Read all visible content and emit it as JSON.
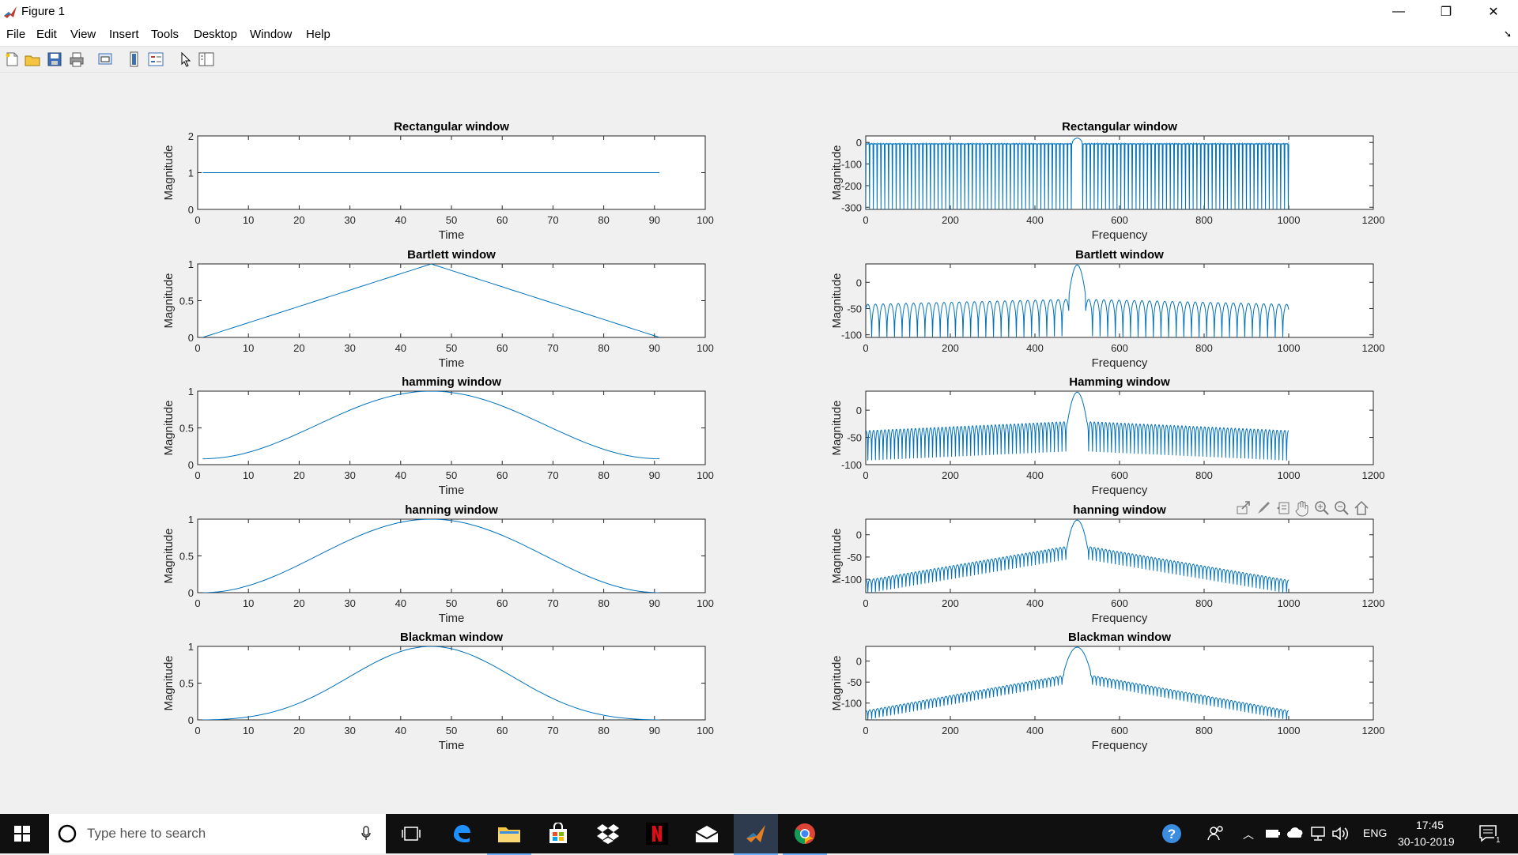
{
  "window": {
    "title": "Figure 1",
    "minimize": "—",
    "maximize": "❐",
    "close": "✕"
  },
  "menu": [
    "File",
    "Edit",
    "View",
    "Insert",
    "Tools",
    "Desktop",
    "Window",
    "Help"
  ],
  "toolbar_icons": [
    "new-figure-icon",
    "open-icon",
    "save-icon",
    "print-icon",
    "link-plot-icon",
    "colorbar-icon",
    "legend-icon",
    "pointer-icon",
    "property-inspector-icon"
  ],
  "axes_toolbar_icons": [
    "export-icon",
    "brush-icon",
    "data-tips-icon",
    "pan-hand-icon",
    "zoom-in-icon",
    "zoom-out-icon",
    "home-icon"
  ],
  "chart_data": [
    {
      "type": "line",
      "title": "Rectangular window",
      "xlabel": "Time",
      "ylabel": "Magnitude",
      "xlim": [
        0,
        100
      ],
      "ylim": [
        0,
        2
      ],
      "xticks": [
        "0",
        "10",
        "20",
        "30",
        "40",
        "50",
        "60",
        "70",
        "80",
        "90",
        "100"
      ],
      "yticks": [
        "0",
        "1",
        "2"
      ],
      "series_kind": "rect",
      "x_end": 91,
      "value": 1
    },
    {
      "type": "line",
      "title": "Rectangular window",
      "xlabel": "Frequency",
      "ylabel": "Magnitude",
      "xlim": [
        0,
        1200
      ],
      "ylim": [
        -310,
        30
      ],
      "xticks": [
        "0",
        "200",
        "400",
        "600",
        "800",
        "1000",
        "1200"
      ],
      "yticks": [
        "-300",
        "-200",
        "-100",
        "0"
      ],
      "series_kind": "spectrum_rect",
      "x_end": 1000,
      "peak_x": 500,
      "peak_db": 20
    },
    {
      "type": "line",
      "title": "Bartlett window",
      "xlabel": "Time",
      "ylabel": "Magnitude",
      "xlim": [
        0,
        100
      ],
      "ylim": [
        0,
        1
      ],
      "xticks": [
        "0",
        "10",
        "20",
        "30",
        "40",
        "50",
        "60",
        "70",
        "80",
        "90",
        "100"
      ],
      "yticks": [
        "0",
        "0.5",
        "1"
      ],
      "series_kind": "bartlett",
      "x_start": 1,
      "x_end": 91
    },
    {
      "type": "line",
      "title": "Bartlett window",
      "xlabel": "Frequency",
      "ylabel": "Magnitude",
      "xlim": [
        0,
        1200
      ],
      "ylim": [
        -105,
        35
      ],
      "xticks": [
        "0",
        "200",
        "400",
        "600",
        "800",
        "1000",
        "1200"
      ],
      "yticks": [
        "-100",
        "-50",
        "0"
      ],
      "series_kind": "spectrum_bartlett",
      "x_end": 1000,
      "peak_x": 500,
      "peak_db": 33
    },
    {
      "type": "line",
      "title": "hamming window",
      "xlabel": "Time",
      "ylabel": "Magnitude",
      "xlim": [
        0,
        100
      ],
      "ylim": [
        0,
        1
      ],
      "xticks": [
        "0",
        "10",
        "20",
        "30",
        "40",
        "50",
        "60",
        "70",
        "80",
        "90",
        "100"
      ],
      "yticks": [
        "0",
        "0.5",
        "1"
      ],
      "series_kind": "hamming",
      "x_start": 1,
      "x_end": 91
    },
    {
      "type": "line",
      "title": "Hamming window",
      "xlabel": "Frequency",
      "ylabel": "Magnitude",
      "xlim": [
        0,
        1200
      ],
      "ylim": [
        -100,
        35
      ],
      "xticks": [
        "0",
        "200",
        "400",
        "600",
        "800",
        "1000",
        "1200"
      ],
      "yticks": [
        "-100",
        "-50",
        "0"
      ],
      "series_kind": "spectrum_hamming",
      "x_end": 1000,
      "peak_x": 500,
      "peak_db": 33
    },
    {
      "type": "line",
      "title": "hanning window",
      "xlabel": "Time",
      "ylabel": "Magnitude",
      "xlim": [
        0,
        100
      ],
      "ylim": [
        0,
        1
      ],
      "xticks": [
        "0",
        "10",
        "20",
        "30",
        "40",
        "50",
        "60",
        "70",
        "80",
        "90",
        "100"
      ],
      "yticks": [
        "0",
        "0.5",
        "1"
      ],
      "series_kind": "hanning",
      "x_start": 1,
      "x_end": 91
    },
    {
      "type": "line",
      "title": "hanning window",
      "xlabel": "Frequency",
      "ylabel": "Magnitude",
      "xlim": [
        0,
        1200
      ],
      "ylim": [
        -130,
        35
      ],
      "xticks": [
        "0",
        "200",
        "400",
        "600",
        "800",
        "1000",
        "1200"
      ],
      "yticks": [
        "-100",
        "-50",
        "0"
      ],
      "series_kind": "spectrum_hanning",
      "x_end": 1000,
      "peak_x": 500,
      "peak_db": 33
    },
    {
      "type": "line",
      "title": "Blackman window",
      "xlabel": "Time",
      "ylabel": "Magnitude",
      "xlim": [
        0,
        100
      ],
      "ylim": [
        0,
        1
      ],
      "xticks": [
        "0",
        "10",
        "20",
        "30",
        "40",
        "50",
        "60",
        "70",
        "80",
        "90",
        "100"
      ],
      "yticks": [
        "0",
        "0.5",
        "1"
      ],
      "series_kind": "blackman",
      "x_start": 1,
      "x_end": 91
    },
    {
      "type": "line",
      "title": "Blackman window",
      "xlabel": "Frequency",
      "ylabel": "Magnitude",
      "xlim": [
        0,
        1200
      ],
      "ylim": [
        -140,
        35
      ],
      "xticks": [
        "0",
        "200",
        "400",
        "600",
        "800",
        "1000",
        "1200"
      ],
      "yticks": [
        "-100",
        "-50",
        "0"
      ],
      "series_kind": "spectrum_blackman",
      "x_end": 1000,
      "peak_x": 500,
      "peak_db": 33
    }
  ],
  "taskbar": {
    "search_placeholder": "Type here to search",
    "language": "ENG",
    "time": "17:45",
    "date": "30-10-2019",
    "notification_count": "1"
  },
  "colors": {
    "line": "#0072BD",
    "taskbar": "#101010"
  }
}
